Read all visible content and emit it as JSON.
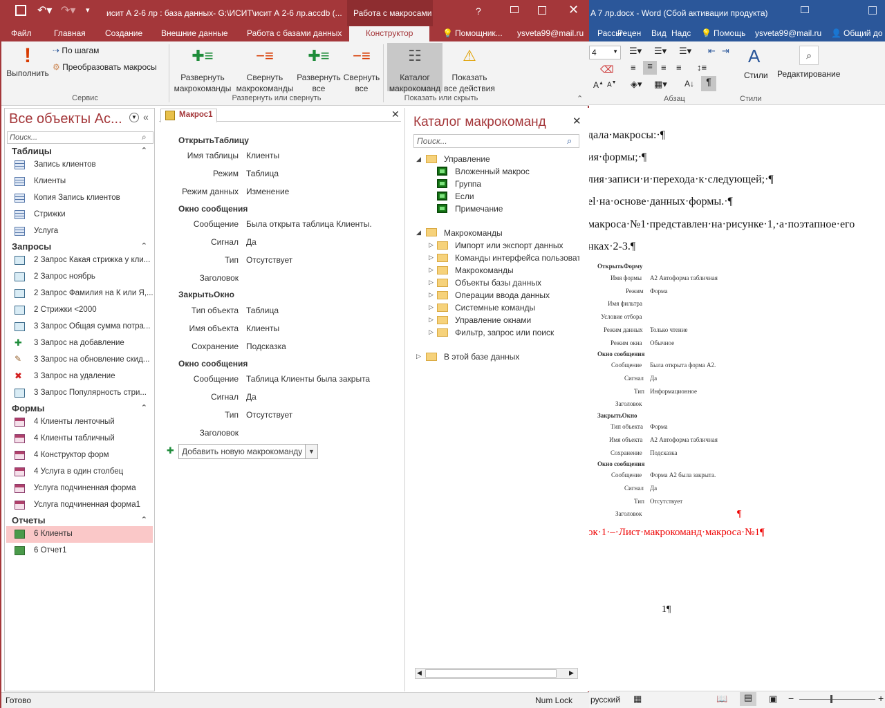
{
  "word": {
    "title": "A 7 лр.docx  -  Word (Сбой активации продукта)",
    "tabs": [
      "Рассы",
      "Рецен",
      "Вид",
      "Надс"
    ],
    "tell_me": "Помощь",
    "user": "ysveta99@mail.ru",
    "share": "Общий до",
    "font_size": "4",
    "groups": {
      "styles_label": "Стили",
      "editing_label": "Редактирование",
      "paragraph": "Абзац",
      "styles": "Стили"
    },
    "doc_lines": [
      "дала·макросы:·¶",
      "ия·формы;·¶",
      "лия·записи·и·перехода·к·следующей;·¶",
      "el·на·основе·данных·формы.·¶",
      "макроса·№1·представлен·на·рисунке·1,·а·поэтапное·его",
      "нках·2-3.¶"
    ],
    "figure": {
      "h1": "ОткрытьФорму",
      "rows1": [
        [
          "Имя формы",
          "А2 Автоформа табличная"
        ],
        [
          "Режим",
          "Форма"
        ],
        [
          "Имя фильтра",
          ""
        ],
        [
          "Условие отбора",
          ""
        ],
        [
          "Режим данных",
          "Только чтение"
        ],
        [
          "Режим окна",
          "Обычное"
        ]
      ],
      "h2": "Окно сообщения",
      "rows2": [
        [
          "Сообщение",
          "Была открыта форма А2."
        ],
        [
          "Сигнал",
          "Да"
        ],
        [
          "Тип",
          "Информационное"
        ],
        [
          "Заголовок",
          ""
        ]
      ],
      "h3": "ЗакрытьОкно",
      "rows3": [
        [
          "Тип объекта",
          "Форма"
        ],
        [
          "Имя объекта",
          "А2 Автоформа табличная"
        ],
        [
          "Сохранение",
          "Подсказка"
        ]
      ],
      "h4": "Окно сообщения",
      "rows4": [
        [
          "Сообщение",
          "Форма А2 была закрыта."
        ],
        [
          "Сигнал",
          "Да"
        ],
        [
          "Тип",
          "Отсутствует"
        ],
        [
          "Заголовок",
          ""
        ]
      ]
    },
    "pilcrow": "¶",
    "caption": "ок·1·–·Лист·макрокоманд·макроса·№1¶",
    "page_number": "1¶",
    "status_lang": "русский"
  },
  "access": {
    "title": "исит А 2-6 лр : база данных- G:\\ИСИТ\\исит А 2-6 лр.accdb (...",
    "context_tab": "Работа с макросами",
    "help": "?",
    "tabs": [
      "Файл",
      "Главная",
      "Создание",
      "Внешние данные",
      "Работа с базами данных",
      "Конструктор"
    ],
    "tell_me": "Помощник...",
    "user": "ysveta99@mail.ru",
    "ribbon": {
      "run": "Выполнить",
      "single_step": "По шагам",
      "convert": "Преобразовать макросы",
      "expand_actions": [
        "Развернуть",
        "макрокоманды"
      ],
      "collapse_actions": [
        "Свернуть",
        "макрокоманды"
      ],
      "expand_all": [
        "Развернуть",
        "все"
      ],
      "collapse_all": [
        "Свернуть",
        "все"
      ],
      "catalog": [
        "Каталог",
        "макрокоманд"
      ],
      "show_all": [
        "Показать",
        "все действия"
      ],
      "group_service": "Сервис",
      "group_expand": "Развернуть или свернуть",
      "group_show": "Показать или скрыть"
    },
    "nav": {
      "title": "Все объекты Ac...",
      "search_placeholder": "Поиск...",
      "sections": [
        {
          "name": "Таблицы",
          "items": [
            "Запись клиентов",
            "Клиенты",
            "Копия Запись клиентов",
            "Стрижки",
            "Услуга"
          ]
        },
        {
          "name": "Запросы",
          "items": [
            "2 Запрос Какая стрижка у кли...",
            "2 Запрос ноябрь",
            "2 Запрос Фамилия на К или Я,...",
            "2 Стрижки <2000",
            "3 Запрос Общая сумма потра...",
            "3 Запрос на добавление",
            "3 Запрос на обновление скид...",
            "3 Запрос на удаление",
            "3 Запрос Популярность стри..."
          ]
        },
        {
          "name": "Формы",
          "items": [
            "4 Клиенты ленточный",
            "4 Клиенты табличный",
            "4 Конструктор форм",
            "4 Услуга в один столбец",
            "Услуга подчиненная форма",
            "Услуга подчиненная форма1"
          ]
        },
        {
          "name": "Отчеты",
          "items": [
            "6 Клиенты",
            "6 Отчет1"
          ]
        }
      ]
    },
    "macro": {
      "tab_label": "Макрос1",
      "open_table": "ОткрытьТаблицу",
      "open_table_args": [
        [
          "Имя таблицы",
          "Клиенты"
        ],
        [
          "Режим",
          "Таблица"
        ],
        [
          "Режим данных",
          "Изменение"
        ]
      ],
      "msg1": "Окно сообщения",
      "msg1_args": [
        [
          "Сообщение",
          "Была открыта таблица Клиенты."
        ],
        [
          "Сигнал",
          "Да"
        ],
        [
          "Тип",
          "Отсутствует"
        ],
        [
          "Заголовок",
          ""
        ]
      ],
      "close_window": "ЗакрытьОкно",
      "close_args": [
        [
          "Тип объекта",
          "Таблица"
        ],
        [
          "Имя объекта",
          "Клиенты"
        ],
        [
          "Сохранение",
          "Подсказка"
        ]
      ],
      "msg2": "Окно сообщения",
      "msg2_args": [
        [
          "Сообщение",
          "Таблица Клиенты была закрыта"
        ],
        [
          "Сигнал",
          "Да"
        ],
        [
          "Тип",
          "Отсутствует"
        ],
        [
          "Заголовок",
          ""
        ]
      ],
      "add_action": "Добавить новую макрокоманду"
    },
    "catalog": {
      "title": "Каталог макрокоманд",
      "search_placeholder": "Поиск...",
      "control": "Управление",
      "control_items": [
        "Вложенный макрос",
        "Группа",
        "Если",
        "Примечание"
      ],
      "actions": "Макрокоманды",
      "action_folders": [
        "Импорт или экспорт данных",
        "Команды интерфейса пользовате",
        "Макрокоманды",
        "Объекты базы данных",
        "Операции ввода данных",
        "Системные команды",
        "Управление окнами",
        "Фильтр, запрос или поиск"
      ],
      "in_db": "В этой базе данных"
    },
    "status": {
      "left": "Готово",
      "right": "Num Lock"
    }
  }
}
